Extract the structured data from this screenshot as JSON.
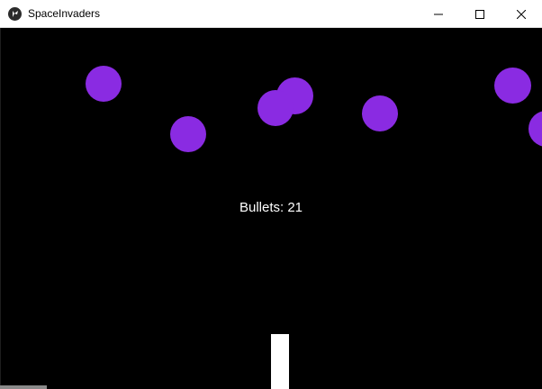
{
  "window": {
    "title": "SpaceInvaders",
    "icon": "kivy-icon",
    "controls": [
      "minimize-icon",
      "maximize-icon",
      "close-icon"
    ]
  },
  "hud": {
    "bullets_label": "Bullets: 21"
  },
  "colors": {
    "background": "#000000",
    "enemy": "#8a2be2",
    "player": "#ffffff",
    "text": "#ffffff"
  }
}
